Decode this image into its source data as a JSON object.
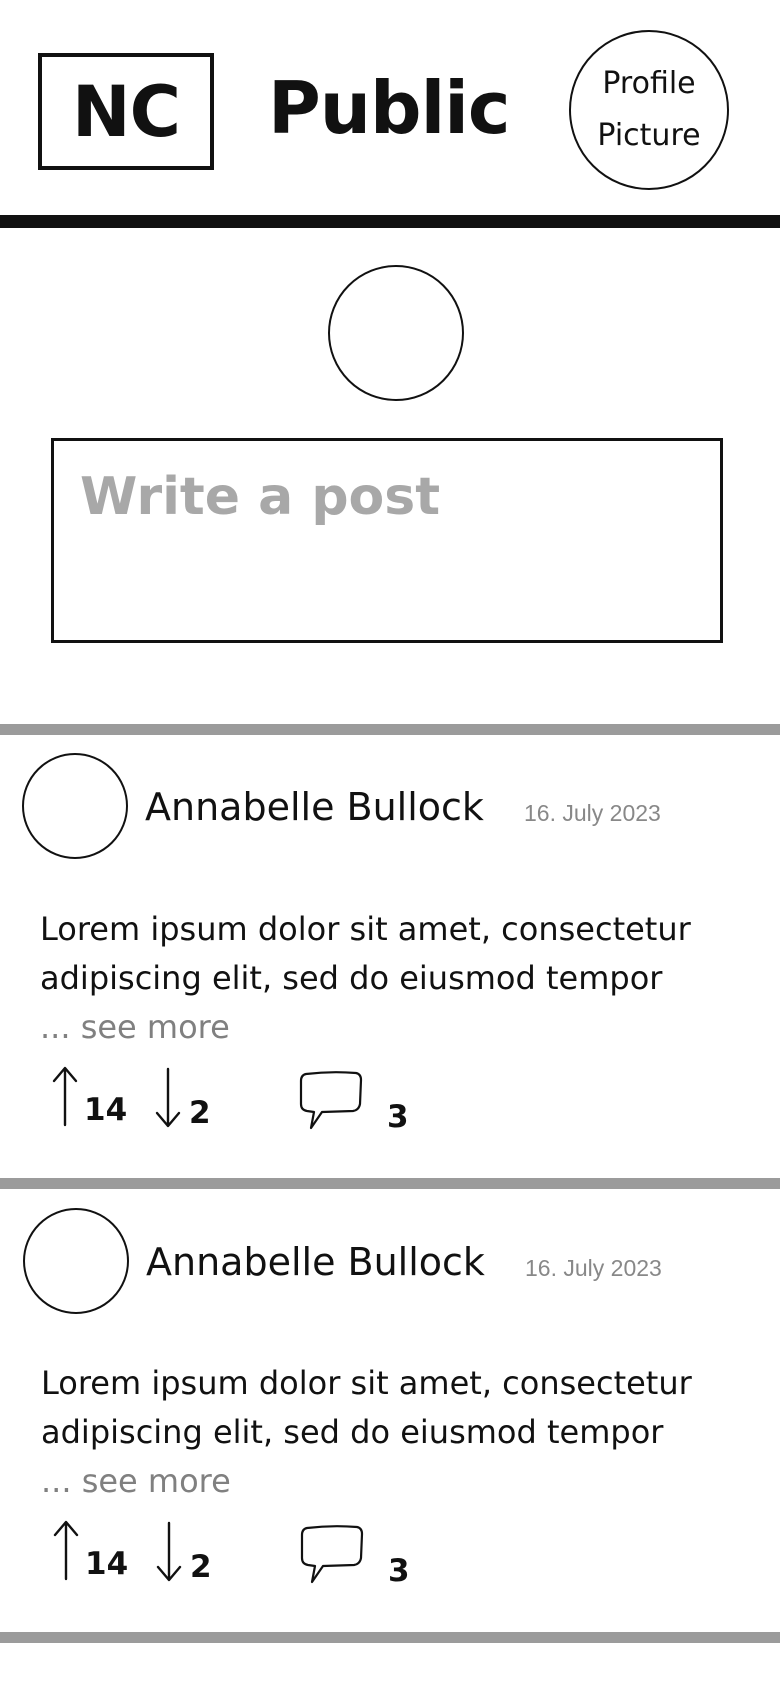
{
  "header": {
    "logo_text": "NC",
    "title": "Public",
    "profile_button": [
      "Profile",
      "Picture"
    ]
  },
  "composer": {
    "placeholder": "Write a post"
  },
  "posts": [
    {
      "author": "Annabelle Bullock",
      "date": "16. July 2023",
      "body": "Lorem ipsum dolor sit amet, consectetur adipiscing elit, sed do eiusmod tempor",
      "see_more": "... see more",
      "upvotes": "14",
      "downvotes": "2",
      "comments": "3"
    },
    {
      "author": "Annabelle Bullock",
      "date": "16. July 2023",
      "body": "Lorem ipsum dolor sit amet, consectetur adipiscing elit, sed do eiusmod tempor",
      "see_more": "... see more",
      "upvotes": "14",
      "downvotes": "2",
      "comments": "3"
    }
  ],
  "icons": {
    "upvote": "up-arrow-icon",
    "downvote": "down-arrow-icon",
    "comments": "speech-bubble-icon"
  },
  "colors": {
    "ink": "#111111",
    "placeholder": "#a8a8a8",
    "muted": "#808080",
    "divider": "#9b9b9b"
  }
}
